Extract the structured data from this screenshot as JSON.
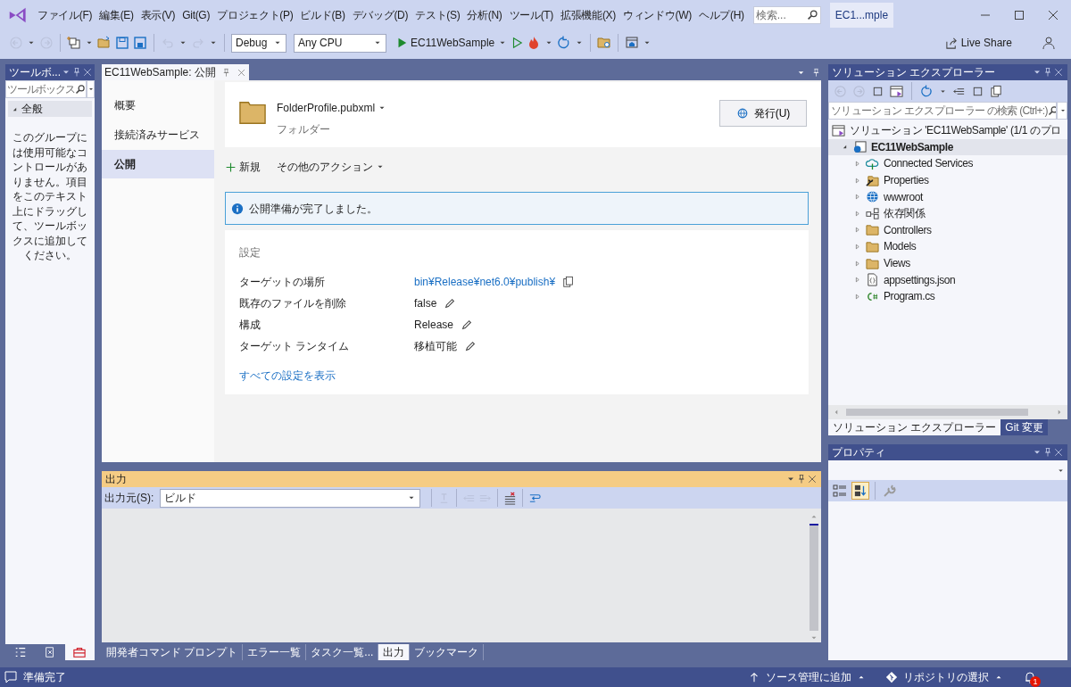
{
  "menu": [
    "ファイル(F)",
    "編集(E)",
    "表示(V)",
    "Git(G)",
    "プロジェクト(P)",
    "ビルド(B)",
    "デバッグ(D)",
    "テスト(S)",
    "分析(N)",
    "ツール(T)",
    "拡張機能(X)",
    "ウィンドウ(W)",
    "ヘルプ(H)"
  ],
  "title_search": {
    "placeholder": "検索..."
  },
  "window_title": "EC1...mple",
  "toolbar": {
    "items": [
      {
        "kind": "back",
        "disabled": true
      },
      {
        "kind": "forward",
        "disabled": true
      },
      {
        "kind": "new-item",
        "disabled": false
      },
      {
        "kind": "open",
        "disabled": false
      },
      {
        "kind": "save",
        "disabled": false
      },
      {
        "kind": "save-all",
        "disabled": false
      },
      {
        "kind": "undo",
        "disabled": true
      },
      {
        "kind": "redo",
        "disabled": true
      }
    ],
    "configuration": "Debug",
    "platform": "Any CPU",
    "startup": "EC11WebSample",
    "live_share": "Live Share"
  },
  "toolbox": {
    "title": "ツールボ...",
    "search": {
      "placeholder": "ツールボックス"
    },
    "group": {
      "label": "全般",
      "expanded": true
    },
    "message": "このグループには使用可能なコントロールがありません。項目をこのテキスト上にドラッグして、ツールボックスに追加してください。",
    "tabs": [
      {
        "kind": "outline",
        "selected": false
      },
      {
        "kind": "test",
        "selected": false
      },
      {
        "kind": "toolbox",
        "selected": true
      }
    ]
  },
  "document": {
    "tab": "EC11WebSample: 公開",
    "nav": [
      {
        "label": "概要",
        "selected": false
      },
      {
        "label": "接続済みサービス",
        "selected": false
      },
      {
        "label": "公開",
        "selected": true
      }
    ],
    "profile": {
      "name": "FolderProfile.pubxml",
      "type": "フォルダー",
      "publish_button": "発行(U)"
    },
    "actions": {
      "new": "新規",
      "more": "その他のアクション"
    },
    "info": "公開準備が完了しました。",
    "settings": {
      "title": "設定",
      "rows": [
        {
          "label": "ターゲットの場所",
          "value": "bin¥Release¥net6.0¥publish¥",
          "kind": "link"
        },
        {
          "label": "既存のファイルを削除",
          "value": "false",
          "kind": "edit"
        },
        {
          "label": "構成",
          "value": "Release",
          "kind": "edit"
        },
        {
          "label": "ターゲット ランタイム",
          "value": "移植可能",
          "kind": "edit"
        }
      ],
      "show_all": "すべての設定を表示"
    }
  },
  "output": {
    "title": "出力",
    "source_label": "出力元(S):",
    "source": "ビルド",
    "tools": [
      {
        "kind": "goto",
        "disabled": true
      },
      {
        "kind": "prev",
        "disabled": true
      },
      {
        "kind": "next",
        "disabled": true
      },
      {
        "kind": "clear",
        "disabled": false
      },
      {
        "kind": "wrap",
        "disabled": false
      }
    ]
  },
  "bottom_tabs": [
    {
      "label": "開発者コマンド プロンプト",
      "selected": false
    },
    {
      "label": "エラー一覧",
      "selected": false
    },
    {
      "label": "タスク一覧...",
      "selected": false
    },
    {
      "label": "出力",
      "selected": true
    },
    {
      "label": "ブックマーク",
      "selected": false
    }
  ],
  "solution_explorer": {
    "title": "ソリューション エクスプローラー",
    "search": {
      "placeholder": "ソリューション エクスプローラー の検索 (Ctrl+:)"
    },
    "tree": [
      {
        "label": "ソリューション 'EC11WebSample' (1/1 のプロ",
        "kind": "solution",
        "children": [
          {
            "label": "EC11WebSample",
            "kind": "project",
            "expanded": true,
            "selected": true,
            "children": [
              {
                "label": "Connected Services",
                "kind": "connected",
                "expanded": false
              },
              {
                "label": "Properties",
                "kind": "properties",
                "expanded": false
              },
              {
                "label": "wwwroot",
                "kind": "globe",
                "expanded": false
              },
              {
                "label": "依存関係",
                "kind": "dependencies",
                "expanded": false
              },
              {
                "label": "Controllers",
                "kind": "folder",
                "expanded": false
              },
              {
                "label": "Models",
                "kind": "folder",
                "expanded": false
              },
              {
                "label": "Views",
                "kind": "folder",
                "expanded": false
              },
              {
                "label": "appsettings.json",
                "kind": "json",
                "expanded": false
              },
              {
                "label": "Program.cs",
                "kind": "csharp",
                "expanded": false
              }
            ]
          }
        ]
      }
    ],
    "tabs": [
      {
        "label": "ソリューション エクスプローラー",
        "selected": true
      },
      {
        "label": "Git 変更",
        "selected": false
      }
    ]
  },
  "properties": {
    "title": "プロパティ",
    "tools": [
      {
        "kind": "categorized",
        "selected": false
      },
      {
        "kind": "alphabetical",
        "selected": true
      },
      {
        "kind": "property-pages",
        "selected": false
      }
    ]
  },
  "status_bar": {
    "text": "準備完了",
    "source_control": "ソース管理に追加",
    "repository": "リポジトリの選択",
    "notifications": "1"
  }
}
